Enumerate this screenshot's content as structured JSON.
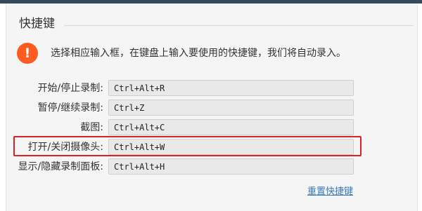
{
  "section": {
    "title": "快捷键"
  },
  "notice": {
    "icon": "exclamation-icon",
    "icon_glyph": "!",
    "text": "选择相应输入框，在键盘上输入要使用的快捷键，我们将自动录入。"
  },
  "shortcuts": [
    {
      "label": "开始/停止录制:",
      "value": "Ctrl+Alt+R"
    },
    {
      "label": "暂停/继续录制:",
      "value": "Ctrl+Z"
    },
    {
      "label": "截图:",
      "value": "Ctrl+Alt+C"
    },
    {
      "label": "打开/关闭摄像头:",
      "value": "Ctrl+Alt+W"
    },
    {
      "label": "显示/隐藏录制面板:",
      "value": "Ctrl+Alt+H"
    }
  ],
  "reset_label": "重置快捷键",
  "colors": {
    "accent": "#ff5a1f",
    "highlight": "#e02020",
    "link": "#3a7ab8",
    "topbar": "#34495e"
  }
}
